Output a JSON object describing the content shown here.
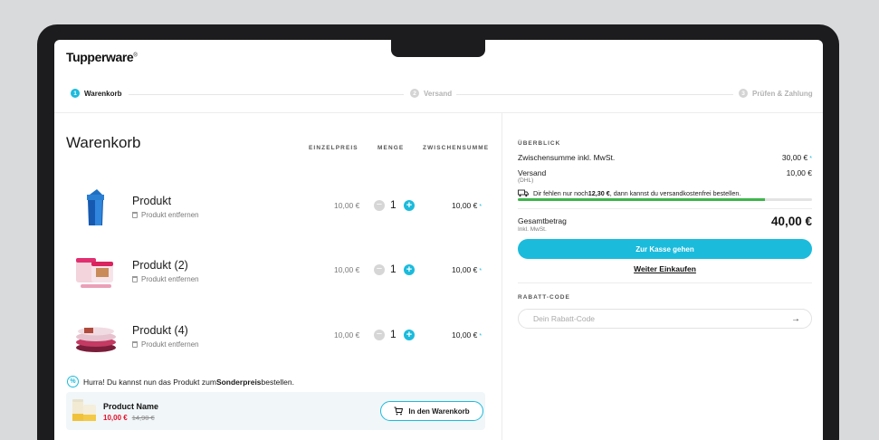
{
  "brand": {
    "logo": "Tupperware",
    "trademark": "®"
  },
  "steps": [
    {
      "num": "1",
      "label": "Warenkorb"
    },
    {
      "num": "2",
      "label": "Versand"
    },
    {
      "num": "3",
      "label": "Prüfen & Zahlung"
    }
  ],
  "cart": {
    "title": "Warenkorb",
    "columns": {
      "unit_price": "EINZELPREIS",
      "quantity": "MENGE",
      "subtotal": "ZWISCHENSUMME"
    },
    "remove_label": "Produkt entfernen",
    "asterisk": "*",
    "items": [
      {
        "name": "Produkt",
        "unit_price": "10,00 €",
        "qty": "1",
        "subtotal": "10,00 €"
      },
      {
        "name": "Produkt (2)",
        "unit_price": "10,00 €",
        "qty": "1",
        "subtotal": "10,00 €"
      },
      {
        "name": "Produkt (4)",
        "unit_price": "10,00 €",
        "qty": "1",
        "subtotal": "10,00 €"
      }
    ]
  },
  "promo": {
    "icon": "percent-icon",
    "msg_pre": "Hurra! Du kannst nun das Produkt zum ",
    "msg_bold": "Sonderpreis",
    "msg_post": " bestellen.",
    "product_name": "Product Name",
    "price": "10,00 €",
    "old_price": "14,90 €",
    "button": "In den Warenkorb"
  },
  "summary": {
    "label": "ÜBERBLICK",
    "subtotal_label": "Zwischensumme inkl. MwSt.",
    "subtotal_value": "30,00 €",
    "shipping_label": "Versand",
    "shipping_carrier": "(DHL)",
    "shipping_value": "10,00 €",
    "free_ship_pre": "Dir fehlen nur noch ",
    "free_ship_amount": "12,30 €",
    "free_ship_post": ", dann kannst du versandkostenfrei bestellen.",
    "free_ship_progress": 0.84,
    "total_label": "Gesamtbetrag",
    "total_sub": "Inkl. MwSt.",
    "total_value": "40,00 €",
    "checkout_button": "Zur Kasse gehen",
    "continue_link": "Weiter Einkaufen",
    "coupon_label": "RABATT-CODE",
    "coupon_placeholder": "Dein Rabatt-Code"
  },
  "colors": {
    "accent": "#1bbbdc",
    "progress": "#3cb64a",
    "sale": "#e3102b"
  }
}
